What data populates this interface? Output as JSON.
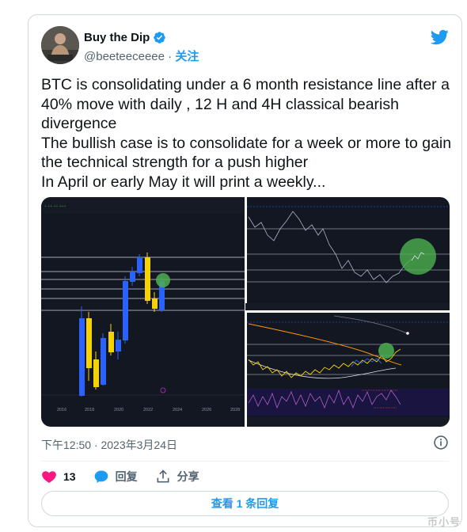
{
  "author": {
    "display_name": "Buy the Dip",
    "handle": "@beeteeceeee",
    "separator": " · ",
    "follow_label": "关注"
  },
  "tweet": {
    "text": "BTC is consolidating under a 6 month resistance line after a 40% move with daily , 12 H and 4H classical bearish divergence\nThe bullish case is to consolidate for a week or more to gain the technical strength for a push higher\nIn April or early May it will print a weekly..."
  },
  "media": {
    "left_chart_xticks": [
      "2016",
      "2018",
      "2020",
      "2022",
      "2024",
      "2026",
      "2028"
    ]
  },
  "timestamp": "下午12:50 · 2023年3月24日",
  "actions": {
    "like_count": "13",
    "reply_label": "回复",
    "share_label": "分享"
  },
  "replies_button": "查看 1 条回复",
  "watermark": "币小号",
  "colors": {
    "accent": "#1d9bf0",
    "like": "#f91880",
    "text": "#0f1419",
    "muted": "#536471",
    "chart_bg": "#131722",
    "candle_blue": "#2962ff",
    "candle_yellow": "#f5d300",
    "highlight_green": "#4caf50"
  }
}
